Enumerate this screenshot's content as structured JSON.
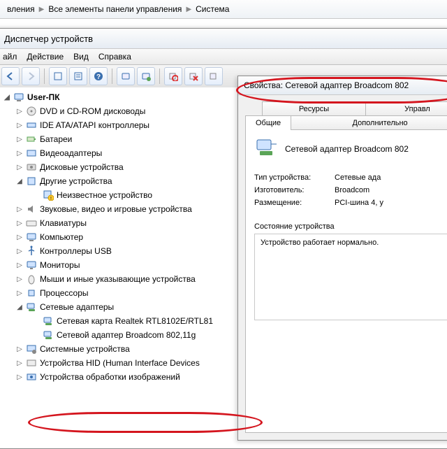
{
  "breadcrumb": {
    "item1": "вления",
    "item2": "Все элементы панели управления",
    "item3": "Система"
  },
  "dm": {
    "title": "Диспетчер устройств",
    "menu": {
      "file": "айл",
      "action": "Действие",
      "view": "Вид",
      "help": "Справка"
    }
  },
  "tree": {
    "root": "User-ПК",
    "items": [
      {
        "label": "DVD и CD-ROM дисководы",
        "open": false
      },
      {
        "label": "IDE ATA/ATAPI контроллеры",
        "open": false
      },
      {
        "label": "Батареи",
        "open": false
      },
      {
        "label": "Видеоадаптеры",
        "open": false
      },
      {
        "label": "Дисковые устройства",
        "open": false
      },
      {
        "label": "Другие устройства",
        "open": true,
        "children": [
          {
            "label": "Неизвестное устройство"
          }
        ]
      },
      {
        "label": "Звуковые, видео и игровые устройства",
        "open": false
      },
      {
        "label": "Клавиатуры",
        "open": false
      },
      {
        "label": "Компьютер",
        "open": false
      },
      {
        "label": "Контроллеры USB",
        "open": false
      },
      {
        "label": "Мониторы",
        "open": false
      },
      {
        "label": "Мыши и иные указывающие устройства",
        "open": false
      },
      {
        "label": "Процессоры",
        "open": false
      },
      {
        "label": "Сетевые адаптеры",
        "open": true,
        "children": [
          {
            "label": "Сетевая карта Realtek RTL8102E/RTL81"
          },
          {
            "label": "Сетевой адаптер Broadcom 802,11g"
          }
        ]
      },
      {
        "label": "Системные устройства",
        "open": false
      },
      {
        "label": "Устройства HID (Human Interface Devices",
        "open": false
      },
      {
        "label": "Устройства обработки изображений",
        "open": false
      }
    ]
  },
  "prop": {
    "title": "Свойства: Сетевой адаптер Broadcom 802",
    "tabs": {
      "resources": "Ресурсы",
      "power": "Управл",
      "general": "Общие",
      "advanced": "Дополнительно"
    },
    "deviceName": "Сетевой адаптер Broadcom 802",
    "type": {
      "k": "Тип устройства:",
      "v": "Сетевые ада"
    },
    "mfr": {
      "k": "Изготовитель:",
      "v": "Broadcom"
    },
    "loc": {
      "k": "Размещение:",
      "v": "PCI-шина 4, у"
    },
    "statusLabel": "Состояние устройства",
    "statusText": "Устройство работает нормально."
  }
}
